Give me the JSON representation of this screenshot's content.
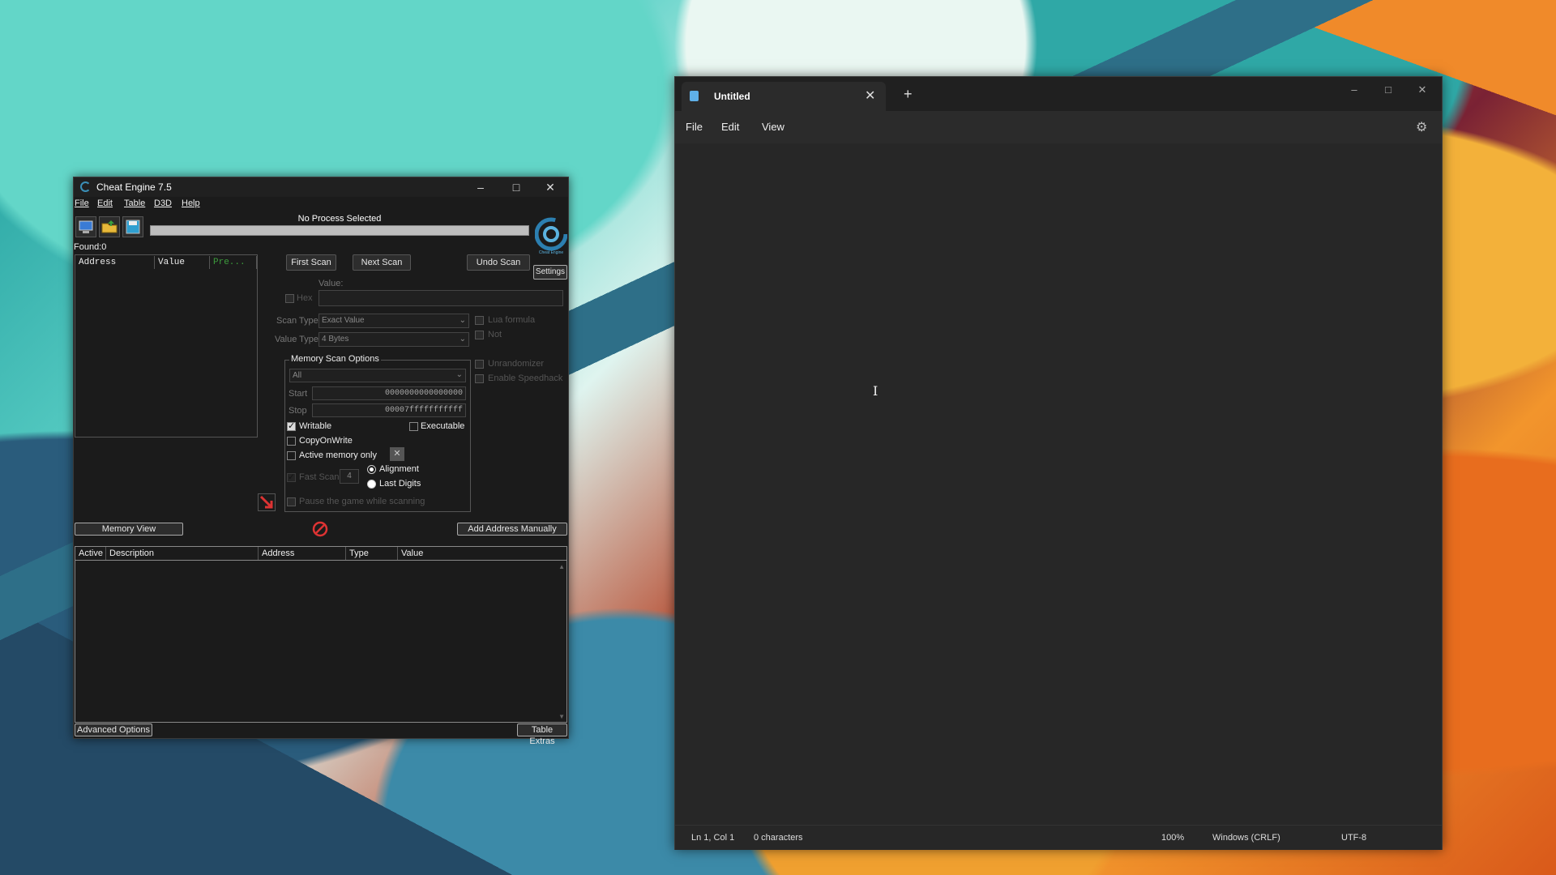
{
  "cheat_engine": {
    "title": "Cheat Engine 7.5",
    "menu": [
      "File",
      "Edit",
      "Table",
      "D3D",
      "Help"
    ],
    "process_label": "No Process Selected",
    "found_label": "Found:0",
    "logo_caption": "Cheat Engine",
    "results_columns": [
      "Address",
      "Value",
      "Pre..."
    ],
    "buttons": {
      "first_scan": "First Scan",
      "next_scan": "Next Scan",
      "undo_scan": "Undo Scan",
      "settings": "Settings",
      "memory_view": "Memory View",
      "add_address": "Add Address Manually",
      "advanced_options": "Advanced Options",
      "table_extras": "Table Extras"
    },
    "value_label": "Value:",
    "hex_label": "Hex",
    "scan_type_label": "Scan Type",
    "scan_type_value": "Exact Value",
    "value_type_label": "Value Type",
    "value_type_value": "4 Bytes",
    "lua_formula": "Lua formula",
    "not_label": "Not",
    "unrandomizer": "Unrandomizer",
    "enable_speedhack": "Enable Speedhack",
    "memory_scan_options": {
      "title": "Memory Scan Options",
      "region": "All",
      "start_label": "Start",
      "start_value": "0000000000000000",
      "stop_label": "Stop",
      "stop_value": "00007fffffffffff",
      "writable": "Writable",
      "executable": "Executable",
      "copy_on_write": "CopyOnWrite",
      "active_memory_only": "Active memory only",
      "fast_scan": "Fast Scan",
      "fast_scan_value": "4",
      "alignment": "Alignment",
      "last_digits": "Last Digits",
      "pause_game": "Pause the game while scanning"
    },
    "address_table_columns": [
      "Active",
      "Description",
      "Address",
      "Type",
      "Value"
    ]
  },
  "notepad": {
    "tab_title": "Untitled",
    "menu": [
      "File",
      "Edit",
      "View"
    ],
    "status": {
      "position": "Ln 1, Col 1",
      "characters": "0 characters",
      "zoom": "100%",
      "line_ending": "Windows (CRLF)",
      "encoding": "UTF-8"
    }
  }
}
